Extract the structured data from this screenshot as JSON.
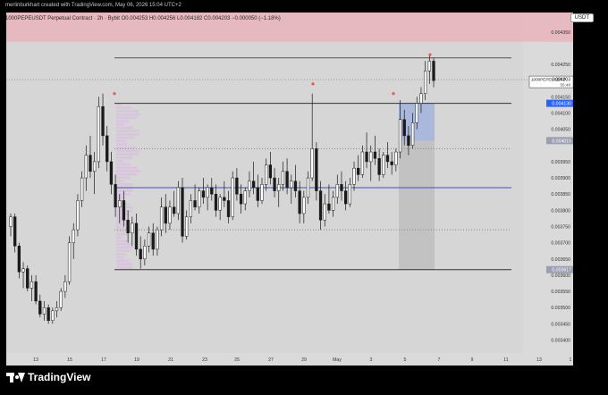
{
  "header": {
    "created_by": "merlinburkhart created with TradingView.com, May 06, 2026 15:04 UTC+2",
    "symbol_line": "1000PEPEUSDT Perpetual Contract · 2h · Bybit  O0.004253  H0.004256  L0.004182  C0.004203  −0.000050 (−1.18%)"
  },
  "currency_badge": "USDT",
  "footer": {
    "brand": "TradingView"
  },
  "chart_data": {
    "type": "candlestick",
    "symbol": "1000PEPEUSDT",
    "timeframe": "2h",
    "exchange": "Bybit",
    "ohlc": {
      "open": 0.004253,
      "high": 0.004256,
      "low": 0.004182,
      "close": 0.004203,
      "change": -5e-05,
      "change_pct": -1.18
    },
    "ylim": [
      0.00336,
      0.00441
    ],
    "y_ticks": [
      "0.004350",
      "0.004250",
      "0.004150",
      "0.004100",
      "0.004050",
      "0.003950",
      "0.003900",
      "0.003850",
      "0.003800",
      "0.003750",
      "0.003700",
      "0.003650",
      "0.003600",
      "0.003550",
      "0.003500",
      "0.003450",
      "0.003400"
    ],
    "x_ticks": [
      "13",
      "15",
      "17",
      "19",
      "21",
      "23",
      "25",
      "27",
      "29",
      "May",
      "3",
      "5",
      "7",
      "9",
      "11",
      "13",
      "1"
    ],
    "price_labels": [
      {
        "text": "1000PEPEUSDT.P",
        "value": 0.004203,
        "tag": "0.004203",
        "sub": "55:48",
        "color": "#ffffff"
      },
      {
        "text": "",
        "value": 0.00413,
        "tag": "0.004130",
        "color": "#2962ff"
      },
      {
        "text": "",
        "value": 0.004015,
        "tag": "0.004015",
        "color": "#9aa0b0"
      },
      {
        "text": "",
        "value": 0.003617,
        "tag": "0.003617",
        "color": "#9aa0b0"
      }
    ],
    "levels": [
      {
        "value": 0.00427,
        "style": "solid",
        "color": "#555555"
      },
      {
        "value": 0.00413,
        "style": "solid",
        "color": "#333333"
      },
      {
        "value": 0.00399,
        "style": "dotted",
        "color": "#888888"
      },
      {
        "value": 0.00387,
        "style": "solid",
        "color": "#3f51b5"
      },
      {
        "value": 0.00374,
        "style": "dotted",
        "color": "#888888"
      },
      {
        "value": 0.003617,
        "style": "solid",
        "color": "#333333"
      }
    ],
    "supply_zone": [
      0.00432,
      0.00441
    ],
    "candles": [
      [
        0.00375,
        0.00379,
        0.00372,
        0.00378
      ],
      [
        0.00378,
        0.00379,
        0.00367,
        0.00369
      ],
      [
        0.00369,
        0.0037,
        0.00359,
        0.00361
      ],
      [
        0.00361,
        0.00364,
        0.00356,
        0.00362
      ],
      [
        0.00362,
        0.00363,
        0.00355,
        0.00356
      ],
      [
        0.00356,
        0.0036,
        0.00352,
        0.00358
      ],
      [
        0.00358,
        0.0036,
        0.00351,
        0.00352
      ],
      [
        0.00352,
        0.00354,
        0.00347,
        0.00348
      ],
      [
        0.00348,
        0.00352,
        0.00346,
        0.0035
      ],
      [
        0.0035,
        0.00351,
        0.00345,
        0.00346
      ],
      [
        0.00346,
        0.0035,
        0.00345,
        0.00349
      ],
      [
        0.00349,
        0.00352,
        0.00347,
        0.0035
      ],
      [
        0.0035,
        0.00356,
        0.00349,
        0.00355
      ],
      [
        0.00355,
        0.0036,
        0.00353,
        0.00358
      ],
      [
        0.00358,
        0.00372,
        0.00357,
        0.0037
      ],
      [
        0.0037,
        0.00376,
        0.00365,
        0.00374
      ],
      [
        0.00374,
        0.00385,
        0.00372,
        0.00383
      ],
      [
        0.00383,
        0.00392,
        0.00381,
        0.0039
      ],
      [
        0.0039,
        0.004,
        0.00386,
        0.00397
      ],
      [
        0.00397,
        0.00403,
        0.0039,
        0.00392
      ],
      [
        0.00392,
        0.00398,
        0.00385,
        0.00395
      ],
      [
        0.00395,
        0.00415,
        0.00393,
        0.00412
      ],
      [
        0.00412,
        0.00416,
        0.004,
        0.00403
      ],
      [
        0.00403,
        0.00406,
        0.00392,
        0.00395
      ],
      [
        0.00395,
        0.00398,
        0.00385,
        0.00388
      ],
      [
        0.00388,
        0.00391,
        0.00378,
        0.00381
      ],
      [
        0.00381,
        0.00385,
        0.00376,
        0.00383
      ],
      [
        0.00383,
        0.00386,
        0.00375,
        0.00377
      ],
      [
        0.00377,
        0.0038,
        0.0037,
        0.00373
      ],
      [
        0.00373,
        0.00378,
        0.00369,
        0.00376
      ],
      [
        0.00376,
        0.00379,
        0.00366,
        0.00368
      ],
      [
        0.00368,
        0.00372,
        0.00362,
        0.00365
      ],
      [
        0.00365,
        0.00371,
        0.00363,
        0.00369
      ],
      [
        0.00369,
        0.00375,
        0.00367,
        0.00373
      ],
      [
        0.00373,
        0.00376,
        0.00366,
        0.00368
      ],
      [
        0.00368,
        0.00375,
        0.00366,
        0.00374
      ],
      [
        0.00374,
        0.00384,
        0.00372,
        0.00381
      ],
      [
        0.00381,
        0.00385,
        0.00373,
        0.00376
      ],
      [
        0.00376,
        0.00383,
        0.00374,
        0.00381
      ],
      [
        0.00381,
        0.00386,
        0.00378,
        0.00379
      ],
      [
        0.00379,
        0.00389,
        0.00377,
        0.00387
      ],
      [
        0.00387,
        0.0039,
        0.0037,
        0.00372
      ],
      [
        0.00372,
        0.0038,
        0.00371,
        0.00378
      ],
      [
        0.00378,
        0.00385,
        0.00376,
        0.00383
      ],
      [
        0.00383,
        0.00388,
        0.0038,
        0.00381
      ],
      [
        0.00381,
        0.00387,
        0.00379,
        0.00386
      ],
      [
        0.00386,
        0.0039,
        0.00382,
        0.00384
      ],
      [
        0.00384,
        0.00388,
        0.0038,
        0.00387
      ],
      [
        0.00387,
        0.0039,
        0.00383,
        0.00385
      ],
      [
        0.00385,
        0.00388,
        0.00378,
        0.0038
      ],
      [
        0.0038,
        0.00385,
        0.00377,
        0.00384
      ],
      [
        0.00384,
        0.00389,
        0.00381,
        0.00383
      ],
      [
        0.00383,
        0.00386,
        0.00376,
        0.00378
      ],
      [
        0.00378,
        0.00392,
        0.00377,
        0.0039
      ],
      [
        0.0039,
        0.00393,
        0.00383,
        0.00385
      ],
      [
        0.00385,
        0.00388,
        0.00379,
        0.00382
      ],
      [
        0.00382,
        0.00387,
        0.0038,
        0.00386
      ],
      [
        0.00386,
        0.00392,
        0.00384,
        0.00389
      ],
      [
        0.00389,
        0.00395,
        0.00385,
        0.00387
      ],
      [
        0.00387,
        0.00391,
        0.00381,
        0.00383
      ],
      [
        0.00383,
        0.0039,
        0.00382,
        0.00388
      ],
      [
        0.00388,
        0.00396,
        0.00386,
        0.00394
      ],
      [
        0.00394,
        0.00398,
        0.00388,
        0.0039
      ],
      [
        0.0039,
        0.00393,
        0.00384,
        0.00386
      ],
      [
        0.00386,
        0.0039,
        0.00381,
        0.00388
      ],
      [
        0.00388,
        0.00395,
        0.00386,
        0.00392
      ],
      [
        0.00392,
        0.00396,
        0.00385,
        0.00387
      ],
      [
        0.00387,
        0.00391,
        0.00382,
        0.00389
      ],
      [
        0.00389,
        0.00394,
        0.00384,
        0.00386
      ],
      [
        0.00386,
        0.00389,
        0.00376,
        0.00379
      ],
      [
        0.00379,
        0.00386,
        0.00376,
        0.00384
      ],
      [
        0.00384,
        0.00392,
        0.00382,
        0.0039
      ],
      [
        0.0039,
        0.00416,
        0.00389,
        0.00399
      ],
      [
        0.00399,
        0.00401,
        0.00383,
        0.00386
      ],
      [
        0.00386,
        0.00389,
        0.00374,
        0.00377
      ],
      [
        0.00377,
        0.00385,
        0.00375,
        0.00382
      ],
      [
        0.00382,
        0.00388,
        0.00379,
        0.0038
      ],
      [
        0.0038,
        0.00386,
        0.00378,
        0.00384
      ],
      [
        0.00384,
        0.00391,
        0.00382,
        0.00388
      ],
      [
        0.00388,
        0.00392,
        0.00383,
        0.00386
      ],
      [
        0.00386,
        0.00389,
        0.0038,
        0.00382
      ],
      [
        0.00382,
        0.0039,
        0.00381,
        0.00388
      ],
      [
        0.00388,
        0.00395,
        0.00386,
        0.00393
      ],
      [
        0.00393,
        0.00397,
        0.00389,
        0.00391
      ],
      [
        0.00391,
        0.004,
        0.0039,
        0.00398
      ],
      [
        0.00398,
        0.00404,
        0.00393,
        0.00395
      ],
      [
        0.00395,
        0.004,
        0.00389,
        0.00398
      ],
      [
        0.00398,
        0.00403,
        0.00394,
        0.00396
      ],
      [
        0.00396,
        0.00399,
        0.00389,
        0.00391
      ],
      [
        0.00391,
        0.00398,
        0.0039,
        0.00397
      ],
      [
        0.00397,
        0.00401,
        0.00393,
        0.00395
      ],
      [
        0.00395,
        0.00398,
        0.00391,
        0.00394
      ],
      [
        0.00394,
        0.00399,
        0.00392,
        0.00398
      ],
      [
        0.00398,
        0.00414,
        0.00396,
        0.00408
      ],
      [
        0.00408,
        0.00411,
        0.004,
        0.00403
      ],
      [
        0.00403,
        0.00406,
        0.00397,
        0.004
      ],
      [
        0.004,
        0.0041,
        0.00399,
        0.00407
      ],
      [
        0.00407,
        0.00415,
        0.00405,
        0.00413
      ],
      [
        0.00413,
        0.00418,
        0.0041,
        0.00416
      ],
      [
        0.00416,
        0.00426,
        0.00414,
        0.00423
      ],
      [
        0.00423,
        0.00428,
        0.00419,
        0.00426
      ],
      [
        0.00426,
        0.00427,
        0.00418,
        0.0042
      ]
    ]
  }
}
